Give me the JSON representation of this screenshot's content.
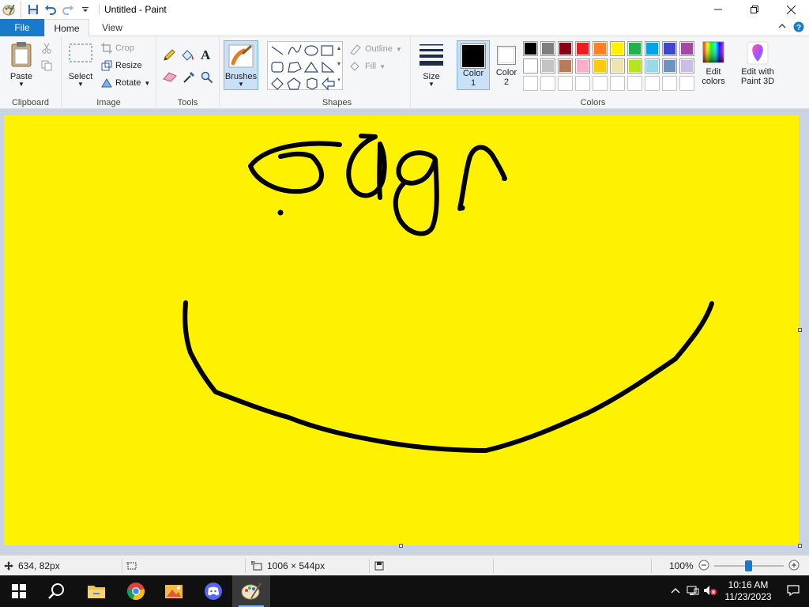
{
  "window": {
    "title": "Untitled - Paint"
  },
  "tabs": {
    "file": "File",
    "home": "Home",
    "view": "View"
  },
  "ribbon": {
    "clipboard": {
      "label": "Clipboard",
      "paste": "Paste"
    },
    "image": {
      "label": "Image",
      "select": "Select",
      "crop": "Crop",
      "resize": "Resize",
      "rotate": "Rotate"
    },
    "tools": {
      "label": "Tools"
    },
    "brushes": {
      "label": "Brushes"
    },
    "shapes": {
      "label": "Shapes",
      "outline": "Outline",
      "fill": "Fill"
    },
    "size": {
      "label": "Size"
    },
    "colors": {
      "label": "Colors",
      "color1_line1": "Color",
      "color1_line2": "1",
      "color2_line1": "Color",
      "color2_line2": "2",
      "edit_line1": "Edit",
      "edit_line2": "colors",
      "paint3d_line1": "Edit with",
      "paint3d_line2": "Paint 3D",
      "color1_value": "#000000",
      "color2_value": "#ffffff",
      "palette_row1": [
        "#000000",
        "#7f7f7f",
        "#880015",
        "#ed1c24",
        "#ff7f27",
        "#fff200",
        "#22b14c",
        "#00a2e8",
        "#3f48cc",
        "#a349a4"
      ],
      "palette_row2": [
        "#ffffff",
        "#c3c3c3",
        "#b97a57",
        "#ffaec9",
        "#ffc90e",
        "#efe4b0",
        "#b5e61d",
        "#99d9ea",
        "#7092be",
        "#c8bfe7"
      ],
      "palette_row3": [
        "#ffffff",
        "#ffffff",
        "#ffffff",
        "#ffffff",
        "#ffffff",
        "#ffffff",
        "#ffffff",
        "#ffffff",
        "#ffffff",
        "#ffffff"
      ]
    }
  },
  "canvas": {
    "background": "#fff200",
    "stroke_color": "#000000"
  },
  "status": {
    "cursor_pos": "634, 82px",
    "canvas_size": "1006 × 544px",
    "zoom": "100%",
    "zoom_fraction": 0.5
  },
  "taskbar": {
    "apps": [
      "windows-start",
      "search",
      "file-explorer",
      "chrome",
      "photos",
      "discord",
      "paint"
    ],
    "time": "10:16 AM",
    "date": "11/23/2023"
  }
}
